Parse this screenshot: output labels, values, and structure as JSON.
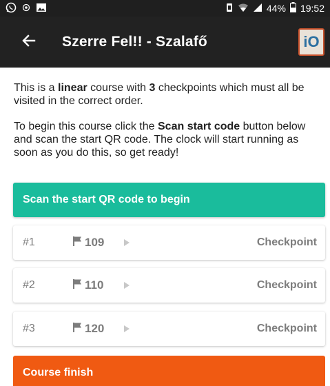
{
  "status_bar": {
    "battery": "44%",
    "time": "19:52",
    "icons": [
      "whatsapp-icon",
      "location-icon",
      "gallery-icon",
      "vibrate-icon",
      "wifi-icon",
      "signal-icon",
      "battery-icon"
    ]
  },
  "app_bar": {
    "title": "Szerre Fel!! - Szalafő",
    "back_icon": "arrow-back-icon",
    "logo_text": "iO"
  },
  "intro": {
    "p1_a": "This is a ",
    "p1_bold1": "linear",
    "p1_b": " course with ",
    "p1_bold2": "3",
    "p1_c": " checkpoints which must all be visited in the correct order.",
    "p2_a": "To begin this course click the ",
    "p2_bold": "Scan start code",
    "p2_b": " button below and scan the start QR code. The clock will start running as soon as you do this, so get ready!"
  },
  "scan_button": {
    "label": "Scan the start QR code to begin",
    "color": "#1abc9c"
  },
  "checkpoints": [
    {
      "index": "#1",
      "code": "109",
      "label": "Checkpoint"
    },
    {
      "index": "#2",
      "code": "110",
      "label": "Checkpoint"
    },
    {
      "index": "#3",
      "code": "120",
      "label": "Checkpoint"
    }
  ],
  "finish": {
    "label": "Course finish",
    "color": "#f05a12"
  }
}
